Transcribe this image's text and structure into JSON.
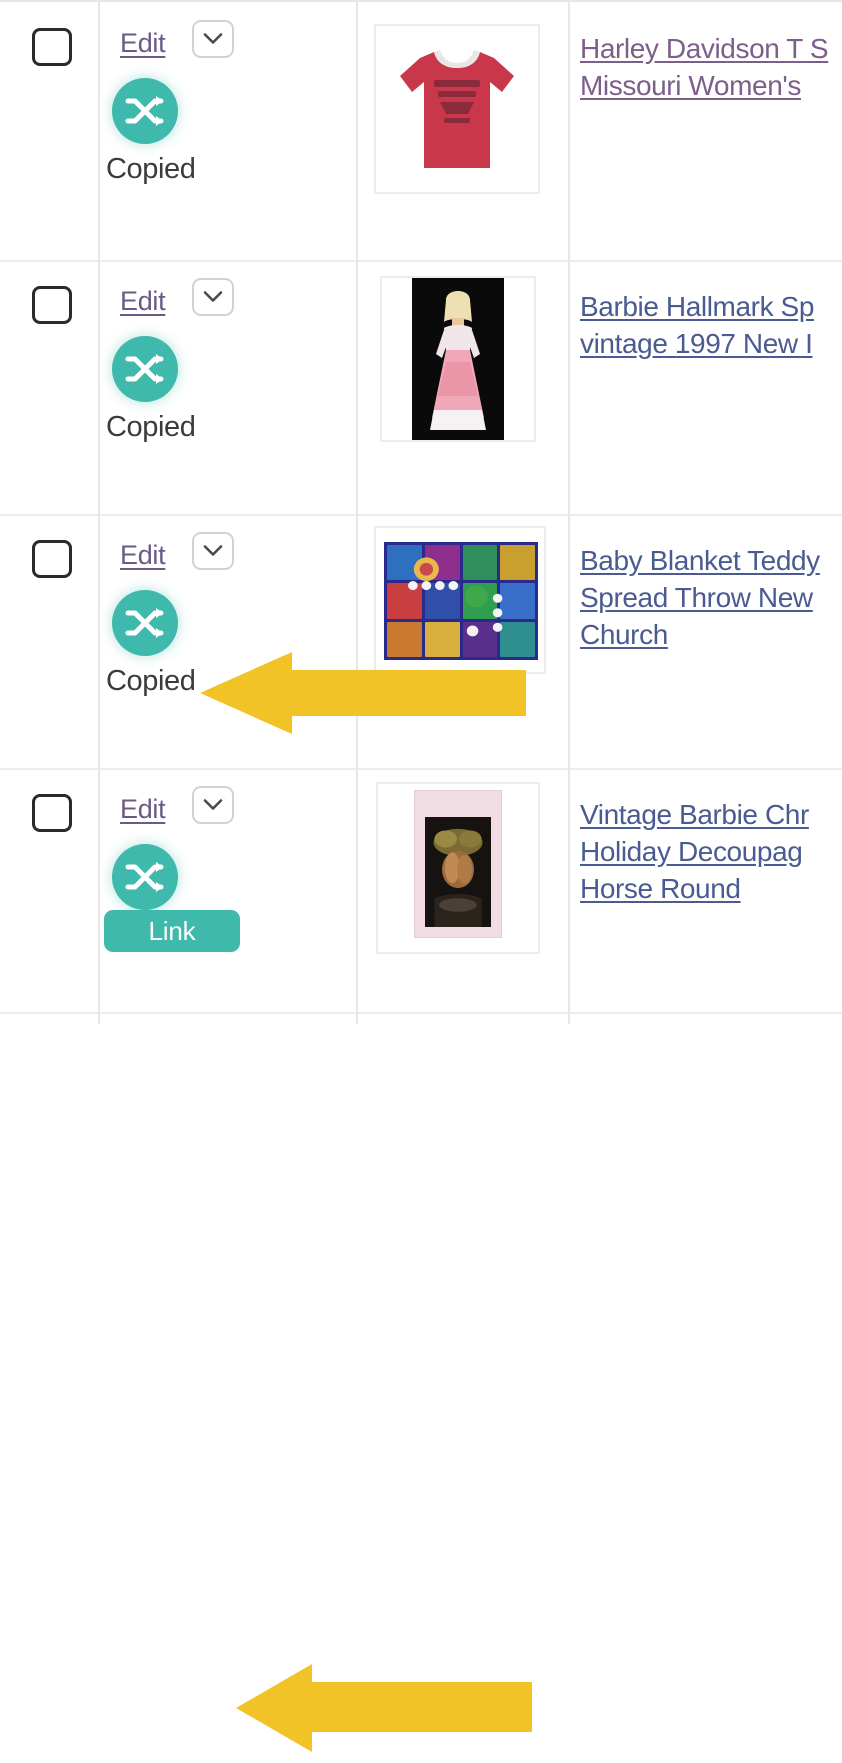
{
  "colors": {
    "status_teal": "#3fb9ac",
    "arrow_yellow": "#f2c327",
    "link_visited": "#7c5e8a",
    "link_unvisited": "#4a5b92",
    "edit_link": "#6a5a86",
    "grid_line": "#ececec"
  },
  "table": {
    "rows": [
      {
        "select": {
          "checked": false
        },
        "actions": {
          "edit_label": "Edit",
          "dropdown_icon": "chevron-down-icon",
          "status_icon": "shuffle-icon",
          "status_type": "text",
          "status_label": "Copied"
        },
        "photo": {
          "alt": "red harley davidson t-shirt"
        },
        "title": {
          "state": "visited",
          "lines": [
            "Harley Davidson T S",
            "Missouri Women's "
          ]
        },
        "annotation": null
      },
      {
        "select": {
          "checked": false
        },
        "actions": {
          "edit_label": "Edit",
          "dropdown_icon": "chevron-down-icon",
          "status_icon": "shuffle-icon",
          "status_type": "text",
          "status_label": "Copied"
        },
        "photo": {
          "alt": "barbie doll in pink gown on black background"
        },
        "title": {
          "state": "unvisited",
          "lines": [
            "Barbie Hallmark Sp",
            "vintage 1997 New I"
          ]
        },
        "annotation": {
          "type": "arrow-left",
          "color": "#f2c327",
          "points_at": "Copied"
        }
      },
      {
        "select": {
          "checked": false
        },
        "actions": {
          "edit_label": "Edit",
          "dropdown_icon": "chevron-down-icon",
          "status_icon": "shuffle-icon",
          "status_type": "text",
          "status_label": "Copied"
        },
        "photo": {
          "alt": "colorful patchwork teddy bear blanket"
        },
        "title": {
          "state": "unvisited",
          "lines": [
            "Baby Blanket Teddy",
            "Spread Throw New",
            "Church"
          ]
        },
        "annotation": null
      },
      {
        "select": {
          "checked": false
        },
        "actions": {
          "edit_label": "Edit",
          "dropdown_icon": "chevron-down-icon",
          "status_icon": "shuffle-icon",
          "status_type": "badge",
          "status_label": "Link"
        },
        "photo": {
          "alt": "vintage barbie christmas ornament in pink package"
        },
        "title": {
          "state": "unvisited",
          "lines": [
            "Vintage Barbie Chr",
            "Holiday Decoupag",
            "Horse Round"
          ]
        },
        "annotation": {
          "type": "arrow-left",
          "color": "#f2c327",
          "points_at": "Link"
        }
      }
    ]
  }
}
